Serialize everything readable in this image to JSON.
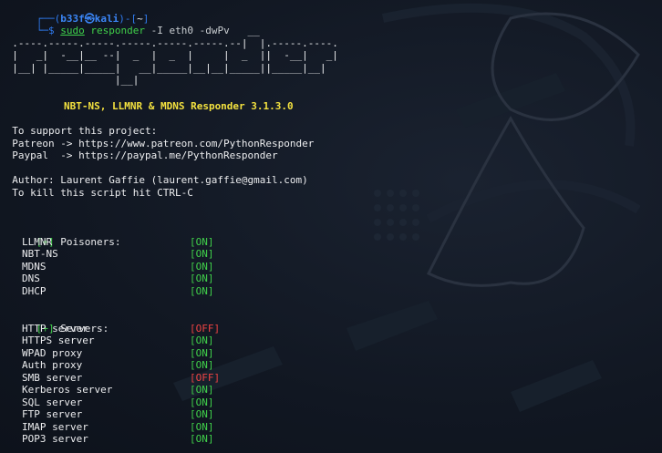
{
  "prompt": {
    "corner_top": "┌──(",
    "user": "b33f",
    "at": "㉿",
    "host": "kali",
    "close": ")-[",
    "dir": "~",
    "close2": "]",
    "corner_bottom": "└─$",
    "cmd_sudo": "sudo",
    "cmd_name": "responder",
    "args": "-I eth0 -dwPv"
  },
  "banner_art": [
    "                                         __",
    "  .----.-----.-----.-----.-----.-----.--|  |.-----.----.",
    "  |   _|  -__|__ --|  _  |  _  |     |  _  ||  -__|   _|",
    "  |__| |_____|_____|   __|_____|__|__|_____||_____|__|",
    "                   |__|"
  ],
  "title": "NBT-NS, LLMNR & MDNS Responder 3.1.3.0",
  "support_lines": [
    "  To support this project:",
    "  Patreon -> https://www.patreon.com/PythonResponder",
    "  Paypal  -> https://paypal.me/PythonResponder"
  ],
  "author_lines": [
    "  Author: Laurent Gaffie (laurent.gaffie@gmail.com)",
    "  To kill this script hit CTRL-C"
  ],
  "poisoners": {
    "header_mark": "[+]",
    "header_text": " Poisoners:",
    "items": [
      {
        "name": "LLMNR",
        "status": "[ON]"
      },
      {
        "name": "NBT-NS",
        "status": "[ON]"
      },
      {
        "name": "MDNS",
        "status": "[ON]"
      },
      {
        "name": "DNS",
        "status": "[ON]"
      },
      {
        "name": "DHCP",
        "status": "[ON]"
      }
    ]
  },
  "servers": {
    "header_mark": "[+]",
    "header_text": " Servers:",
    "items": [
      {
        "name": "HTTP server",
        "status": "[OFF]"
      },
      {
        "name": "HTTPS server",
        "status": "[ON]"
      },
      {
        "name": "WPAD proxy",
        "status": "[ON]"
      },
      {
        "name": "Auth proxy",
        "status": "[ON]"
      },
      {
        "name": "SMB server",
        "status": "[OFF]"
      },
      {
        "name": "Kerberos server",
        "status": "[ON]"
      },
      {
        "name": "SQL server",
        "status": "[ON]"
      },
      {
        "name": "FTP server",
        "status": "[ON]"
      },
      {
        "name": "IMAP server",
        "status": "[ON]"
      },
      {
        "name": "POP3 server",
        "status": "[ON]"
      }
    ]
  },
  "colors": {
    "on": "#40d04a",
    "off": "#f04343",
    "title": "#f4e23f",
    "prompt": "#2f7bf0"
  }
}
